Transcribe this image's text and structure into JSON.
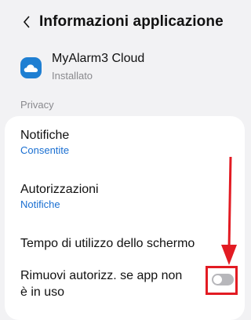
{
  "header": {
    "back_icon": "chevron-left-icon",
    "title": "Informazioni applicazione"
  },
  "app": {
    "icon": "cloud-icon",
    "icon_color": "#1f7fd2",
    "name": "MyAlarm3 Cloud",
    "status": "Installato"
  },
  "privacy": {
    "section_label": "Privacy",
    "items": [
      {
        "title": "Notifiche",
        "subtitle": "Consentite"
      },
      {
        "title": "Autorizzazioni",
        "subtitle": "Notifiche"
      },
      {
        "title": "Tempo di utilizzo dello schermo"
      },
      {
        "title": "Rimuovi autorizz. se app non è in uso",
        "toggle": "off"
      }
    ]
  },
  "colors": {
    "accent": "#1a6fd1",
    "annotation": "#e21b23",
    "toggle_off": "#b7b7bb"
  },
  "annotation": {
    "arrow_icon": "red-arrow-icon",
    "box": "red-highlight-box"
  }
}
